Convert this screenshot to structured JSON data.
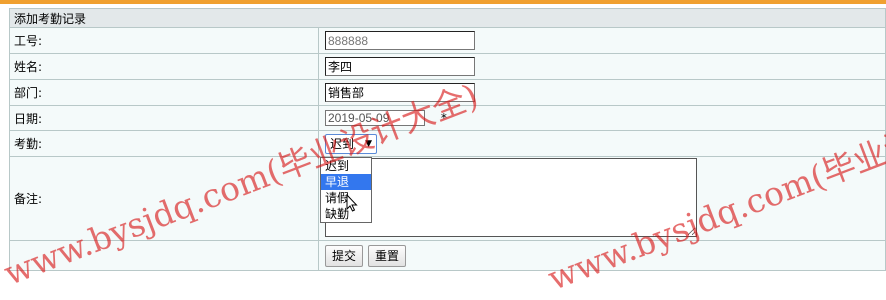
{
  "form": {
    "title": "添加考勤记录",
    "rows": {
      "id": {
        "label": "工号:",
        "value": "888888"
      },
      "name": {
        "label": "姓名:",
        "value": "李四"
      },
      "dept": {
        "label": "部门:",
        "value": "销售部"
      },
      "date": {
        "label": "日期:",
        "value": "2019-05-09",
        "required_mark": "*"
      },
      "attendance": {
        "label": "考勤:",
        "selected": "迟到"
      },
      "remark": {
        "label": "备注:",
        "value": ""
      }
    },
    "attendance_options": [
      "迟到",
      "早退",
      "请假",
      "缺勤"
    ],
    "highlighted_option": "早退",
    "buttons": {
      "submit": "提交",
      "reset": "重置"
    }
  },
  "watermark": {
    "line1": "www.bysjdq.com(毕业设计大全)"
  },
  "colors": {
    "top_bar": "#f0a030",
    "watermark": "#d71414",
    "selection": "#3377ee"
  }
}
